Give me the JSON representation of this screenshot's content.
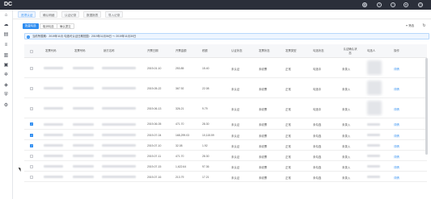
{
  "topbar": {
    "logo": "DC",
    "icons": [
      "grid-icon",
      "help-icon",
      "info-icon",
      "user-icon",
      "clock-icon"
    ]
  },
  "sidebar": {
    "icons": [
      "home-icon",
      "cloud-icon",
      "document-icon",
      "layers-icon",
      "chart-icon",
      "invoice-icon",
      "settings-icon",
      "box-icon",
      "shield-icon",
      "gear-icon"
    ]
  },
  "tabs": [
    "进项认证",
    "确认明细",
    "认证记录",
    "数据报表",
    "导入记录"
  ],
  "toolbar": {
    "primary": "批量勾选",
    "secondary1": "取消勾选",
    "secondary2": "确认提交",
    "filter": "筛选",
    "refresh_icon": "refresh-icon"
  },
  "alert": "当前所属期：2019年11月  勾选可认证日期范围：2019年11月06日 ～ 2019年11月30日",
  "table": {
    "headers": [
      "发票代码",
      "发票号码",
      "销方名称",
      "开票日期",
      "开票金额",
      "税额",
      "认证状态",
      "发票状态",
      "发票类型",
      "勾选状态",
      "认证确认状态",
      "勾选人",
      "操作"
    ],
    "rows": [
      {
        "date": "2019-01-10",
        "amount": "253.85",
        "tax": "15.40",
        "auth": "未认证",
        "status": "未收票",
        "type": "正常",
        "check": "勾选中",
        "confirm": "未录入",
        "action": "详情",
        "checked": false,
        "disabled": true
      },
      {
        "date": "2019-05-22",
        "amount": "367.92",
        "tax": "22.08",
        "auth": "未认证",
        "status": "未收票",
        "type": "正常",
        "check": "勾选中",
        "confirm": "未录入",
        "action": "详情",
        "checked": false,
        "disabled": true
      },
      {
        "date": "2019-06-13",
        "amount": "326.21",
        "tax": "9.79",
        "auth": "未认证",
        "status": "未收票",
        "type": "正常",
        "check": "勾选中",
        "confirm": "未录入",
        "action": "详情",
        "checked": false,
        "disabled": true
      },
      {
        "date": "2019-06-05",
        "amount": "471.70",
        "tax": "28.30",
        "auth": "未认证",
        "status": "未收票",
        "type": "正常",
        "check": "未勾选",
        "confirm": "未录入",
        "action": "详情",
        "checked": true,
        "disabled": false
      },
      {
        "date": "2019-07-04",
        "amount": "168,299.03",
        "tax": "10,115.59",
        "auth": "未认证",
        "status": "未收票",
        "type": "正常",
        "check": "未勾选",
        "confirm": "未录入",
        "action": "详情",
        "checked": true,
        "disabled": false
      },
      {
        "date": "2019-07-10",
        "amount": "32.08",
        "tax": "1.92",
        "auth": "未认证",
        "status": "未收票",
        "type": "正常",
        "check": "未勾选",
        "confirm": "未录入",
        "action": "详情",
        "checked": true,
        "disabled": false
      },
      {
        "date": "2019-07-11",
        "amount": "471.70",
        "tax": "28.30",
        "auth": "未认证",
        "status": "未收票",
        "type": "正常",
        "check": "未勾选",
        "confirm": "未录入",
        "action": "详情",
        "checked": false,
        "disabled": false
      },
      {
        "date": "2019-07-15",
        "amount": "1,622.64",
        "tax": "97.36",
        "auth": "未认证",
        "status": "未收票",
        "type": "正常",
        "check": "未勾选",
        "confirm": "未录入",
        "action": "详情",
        "checked": false,
        "disabled": false
      },
      {
        "date": "2019-07-16",
        "amount": "213.79",
        "tax": "17.21",
        "auth": "未认证",
        "status": "未收票",
        "type": "正常",
        "check": "未勾选",
        "confirm": "未录入",
        "action": "详情",
        "checked": false,
        "disabled": false
      }
    ]
  },
  "colors": {
    "accent": "#2d8cf0",
    "topbar": "#2b2f3a"
  }
}
